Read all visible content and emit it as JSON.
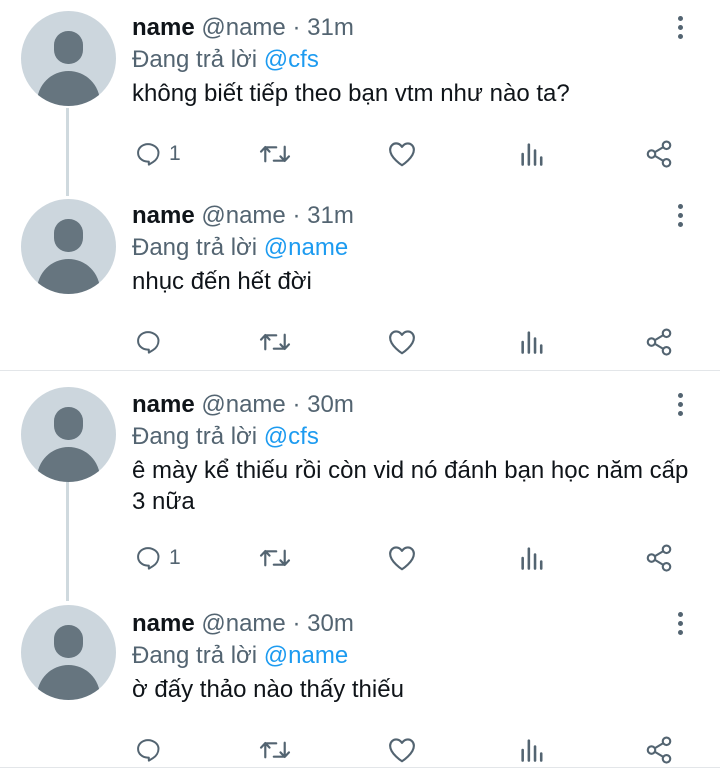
{
  "tweets": [
    {
      "name": "name",
      "handle": "@name",
      "time": "31m",
      "reply_prefix": "Đang trả lời",
      "reply_to": "@cfs",
      "text": "không biết tiếp theo bạn vtm như nào ta?",
      "reply_count": "1",
      "icons": [
        "reply-icon",
        "retweet-icon",
        "like-icon",
        "analytics-icon",
        "share-icon",
        "more-icon"
      ]
    },
    {
      "name": "name",
      "handle": "@name",
      "time": "31m",
      "reply_prefix": "Đang trả lời",
      "reply_to": "@name",
      "text": "nhục đến hết đời",
      "reply_count": "",
      "icons": [
        "reply-icon",
        "retweet-icon",
        "like-icon",
        "analytics-icon",
        "share-icon",
        "more-icon"
      ]
    },
    {
      "name": "name",
      "handle": "@name",
      "time": "30m",
      "reply_prefix": "Đang trả lời",
      "reply_to": "@cfs",
      "text": "ê mày kể thiếu rồi còn vid nó đánh bạn học năm cấp 3 nữa",
      "reply_count": "1",
      "icons": [
        "reply-icon",
        "retweet-icon",
        "like-icon",
        "analytics-icon",
        "share-icon",
        "more-icon"
      ]
    },
    {
      "name": "name",
      "handle": "@name",
      "time": "30m",
      "reply_prefix": "Đang trả lời",
      "reply_to": "@name",
      "text": "ờ đấy thảo nào thấy thiếu",
      "reply_count": "",
      "icons": [
        "reply-icon",
        "retweet-icon",
        "like-icon",
        "analytics-icon",
        "share-icon",
        "more-icon"
      ]
    }
  ],
  "colors": {
    "text": "#0f1419",
    "secondary": "#536471",
    "mention": "#1d9bf0",
    "avatar_bg": "#ccd6dd",
    "avatar_fg": "#66757f",
    "thread_line": "#cfd9de",
    "separator": "#e3e6e9"
  }
}
